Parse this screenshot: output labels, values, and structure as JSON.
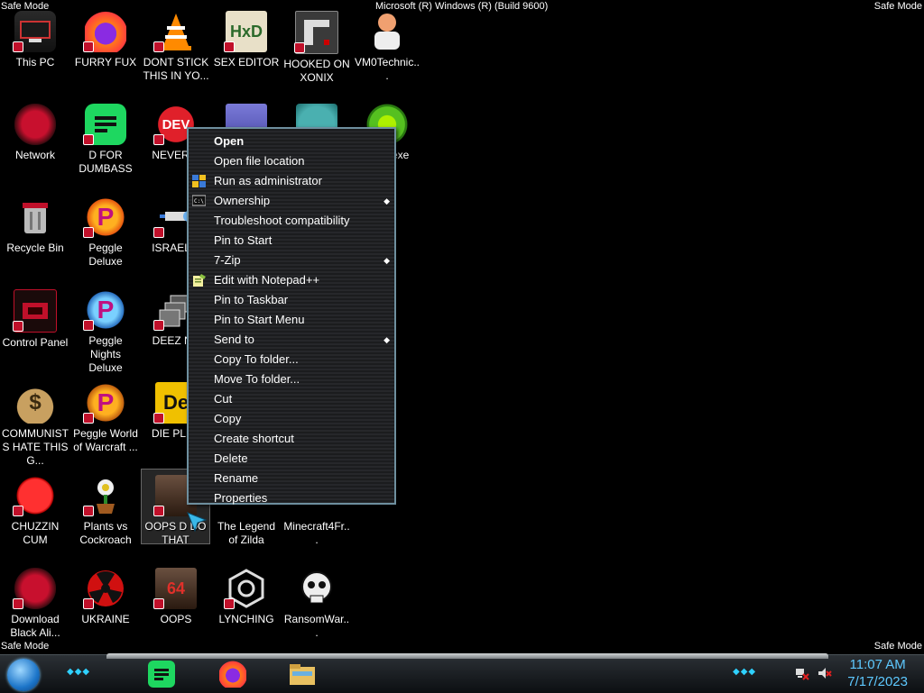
{
  "overlay": {
    "safe_mode": "Safe Mode",
    "build": "Microsoft (R) Windows (R) (Build 9600)"
  },
  "desktop_icons": [
    {
      "label": "This PC"
    },
    {
      "label": "FURRY FUX"
    },
    {
      "label": "DONT STICK THIS IN YO..."
    },
    {
      "label": "SEX EDITOR"
    },
    {
      "label": "HOOKED ON XONIX"
    },
    {
      "label": "VM0Technic..."
    },
    {
      "label": "Network"
    },
    {
      "label": "D FOR DUMBASS"
    },
    {
      "label": "NEVER U"
    },
    {
      "label": "exe"
    },
    {
      "label": "Recycle Bin"
    },
    {
      "label": "Peggle Deluxe"
    },
    {
      "label": "ISRAEL S"
    },
    {
      "label": "Control Panel"
    },
    {
      "label": "Peggle Nights Deluxe"
    },
    {
      "label": "DEEZ NU"
    },
    {
      "label": "COMMUNISTS HATE THIS G..."
    },
    {
      "label": "Peggle World of Warcraft ..."
    },
    {
      "label": "DIE PLEA"
    },
    {
      "label": "CHUZZIN CUM"
    },
    {
      "label": "Plants vs Cockroach"
    },
    {
      "label": "OOPS D DO THAT"
    },
    {
      "label": "The Legend of Zilda"
    },
    {
      "label": "Minecraft4Fr..."
    },
    {
      "label": "Download Black Ali..."
    },
    {
      "label": "UKRAINE"
    },
    {
      "label": "OOPS"
    },
    {
      "label": "LYNCHING"
    },
    {
      "label": "RansomWar..."
    }
  ],
  "context_menu": {
    "items": [
      {
        "label": "Open"
      },
      {
        "label": "Open file location"
      },
      {
        "label": "Run as administrator"
      },
      {
        "label": "Ownership"
      },
      {
        "label": "Troubleshoot compatibility"
      },
      {
        "label": "Pin to Start"
      },
      {
        "label": "7-Zip"
      },
      {
        "label": "Edit with Notepad++"
      },
      {
        "label": "Pin to Taskbar"
      },
      {
        "label": "Pin to Start Menu"
      },
      {
        "label": "Send to"
      },
      {
        "label": "Copy To folder..."
      },
      {
        "label": "Move To folder..."
      },
      {
        "label": "Cut"
      },
      {
        "label": "Copy"
      },
      {
        "label": "Create shortcut"
      },
      {
        "label": "Delete"
      },
      {
        "label": "Rename"
      },
      {
        "label": "Properties"
      }
    ]
  },
  "taskbar": {
    "time": "11:07 AM",
    "date": "7/17/2023"
  },
  "colors": {
    "clock": "#5ec9ff",
    "menu_border": "#6e8f9e",
    "badge": "#c0102a"
  }
}
